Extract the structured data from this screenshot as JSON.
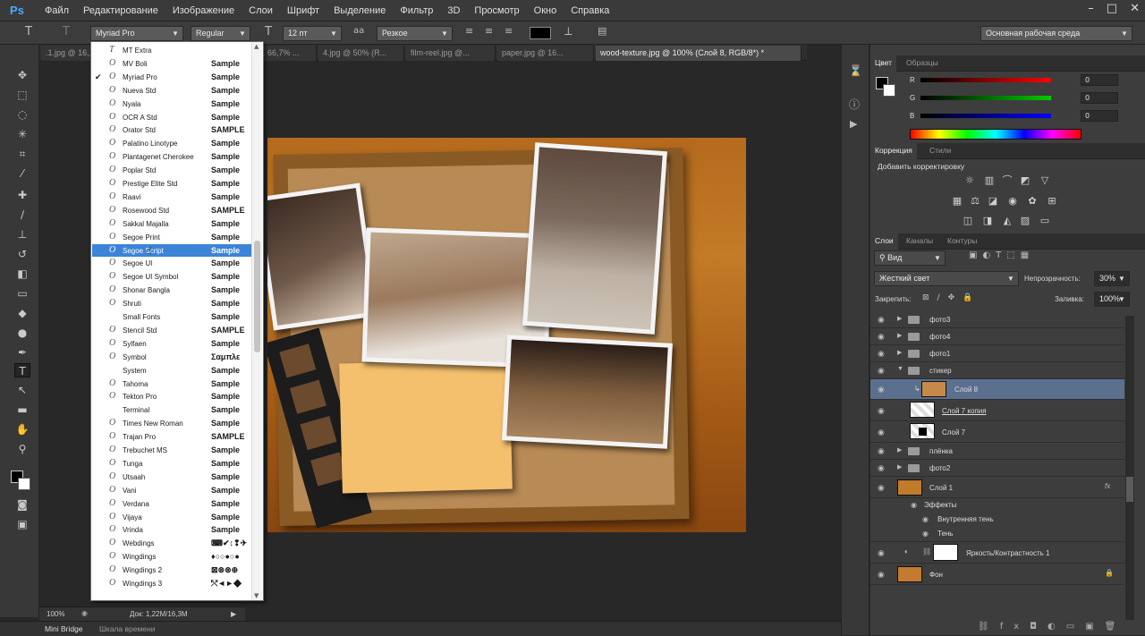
{
  "app": {
    "logo": "Ps"
  },
  "menu": [
    "Файл",
    "Редактирование",
    "Изображение",
    "Слои",
    "Шрифт",
    "Выделение",
    "Фильтр",
    "3D",
    "Просмотр",
    "Окно",
    "Справка"
  ],
  "window_controls": [
    "–",
    "□",
    "✕"
  ],
  "options": {
    "font_family": "Myriad Pro",
    "font_style": "Regular",
    "font_size": "12 пт",
    "antialias": "Резкое",
    "workspace": "Основная рабочая среда"
  },
  "tabs": [
    {
      "label": ".1.jpg @ 16,..."
    },
    {
      "label": "... 66,7% ..."
    },
    {
      "label": "4.jpg @ 50% (R..."
    },
    {
      "label": "film-reel.jpg @..."
    },
    {
      "label": "paper.jpg @ 16..."
    },
    {
      "label": "wood-texture.jpg @ 100% (Слой 8, RGB/8*) *"
    }
  ],
  "font_list": [
    {
      "name": "MT Extra",
      "sample": "",
      "icon": "T"
    },
    {
      "name": "MV Boli",
      "sample": "Sample",
      "icon": "O"
    },
    {
      "name": "Myriad Pro",
      "sample": "Sample",
      "icon": "O",
      "checked": true
    },
    {
      "name": "Nueva Std",
      "sample": "Sample",
      "icon": "O"
    },
    {
      "name": "Nyala",
      "sample": "Sample",
      "icon": "O"
    },
    {
      "name": "OCR A Std",
      "sample": "Sample",
      "icon": "O"
    },
    {
      "name": "Orator Std",
      "sample": "SAMPLE",
      "icon": "O"
    },
    {
      "name": "Palatino Linotype",
      "sample": "Sample",
      "icon": "O"
    },
    {
      "name": "Plantagenet Cherokee",
      "sample": "Sample",
      "icon": "O"
    },
    {
      "name": "Poplar Std",
      "sample": "Sample",
      "icon": "O"
    },
    {
      "name": "Prestige Elite Std",
      "sample": "Sample",
      "icon": "O"
    },
    {
      "name": "Raavi",
      "sample": "Sample",
      "icon": "O"
    },
    {
      "name": "Rosewood Std",
      "sample": "SAMPLE",
      "icon": "O"
    },
    {
      "name": "Sakkal Majalla",
      "sample": "Sample",
      "icon": "O"
    },
    {
      "name": "Segoe Print",
      "sample": "Sample",
      "icon": "O"
    },
    {
      "name": "Segoe Script",
      "sample": "Sample",
      "icon": "O",
      "selected": true
    },
    {
      "name": "Segoe UI",
      "sample": "Sample",
      "icon": "O"
    },
    {
      "name": "Segoe UI Symbol",
      "sample": "Sample",
      "icon": "O"
    },
    {
      "name": "Shonar Bangla",
      "sample": "Sample",
      "icon": "O"
    },
    {
      "name": "Shruti",
      "sample": "Sample",
      "icon": "O"
    },
    {
      "name": "Small Fonts",
      "sample": "Sample",
      "icon": ""
    },
    {
      "name": "Stencil Std",
      "sample": "SAMPLE",
      "icon": "O"
    },
    {
      "name": "Sylfaen",
      "sample": "Sample",
      "icon": "O"
    },
    {
      "name": "Symbol",
      "sample": "Σαμπλε",
      "icon": "O"
    },
    {
      "name": "System",
      "sample": "Sample",
      "icon": ""
    },
    {
      "name": "Tahoma",
      "sample": "Sample",
      "icon": "O"
    },
    {
      "name": "Tekton Pro",
      "sample": "Sample",
      "icon": "O"
    },
    {
      "name": "Terminal",
      "sample": "Sample",
      "icon": ""
    },
    {
      "name": "Times New Roman",
      "sample": "Sample",
      "icon": "O"
    },
    {
      "name": "Trajan Pro",
      "sample": "SAMPLE",
      "icon": "O"
    },
    {
      "name": "Trebuchet MS",
      "sample": "Sample",
      "icon": "O"
    },
    {
      "name": "Tunga",
      "sample": "Sample",
      "icon": "O"
    },
    {
      "name": "Utsaah",
      "sample": "Sample",
      "icon": "O"
    },
    {
      "name": "Vani",
      "sample": "Sample",
      "icon": "O"
    },
    {
      "name": "Verdana",
      "sample": "Sample",
      "icon": "O"
    },
    {
      "name": "Vijaya",
      "sample": "Sample",
      "icon": "O"
    },
    {
      "name": "Vrinda",
      "sample": "Sample",
      "icon": "O"
    },
    {
      "name": "Webdings",
      "sample": "⌨✔↕❢✈",
      "icon": "O"
    },
    {
      "name": "Wingdings",
      "sample": "♦○○●○●",
      "icon": "O"
    },
    {
      "name": "Wingdings 2",
      "sample": "⊠⊗⊗⊕",
      "icon": "O"
    },
    {
      "name": "Wingdings 3",
      "sample": "⤲◄►◆",
      "icon": "O"
    }
  ],
  "status": {
    "zoom": "100%",
    "doc": "Док: 1,22M/16,3M"
  },
  "bottom_tabs": [
    "Mini Bridge",
    "Шкала времени"
  ],
  "color_panel": {
    "tabs": [
      "Цвет",
      "Образцы"
    ],
    "sliders": [
      {
        "label": "R",
        "value": "0"
      },
      {
        "label": "G",
        "value": "0"
      },
      {
        "label": "B",
        "value": "0"
      }
    ]
  },
  "adjust_panel": {
    "tabs": [
      "Коррекция",
      "Стили"
    ],
    "title": "Добавить корректировку"
  },
  "layers_panel": {
    "tabs": [
      "Слои",
      "Каналы",
      "Контуры"
    ],
    "filter": "Вид",
    "blend_mode": "Жесткий свет",
    "opacity_label": "Непрозрачность:",
    "opacity": "30%",
    "lock_label": "Закрепить:",
    "fill_label": "Заливка:",
    "fill": "100%",
    "layers": [
      {
        "name": "фото3",
        "kind": "group"
      },
      {
        "name": "фото4",
        "kind": "group"
      },
      {
        "name": "фото1",
        "kind": "group"
      },
      {
        "name": "стикер",
        "kind": "group-open"
      },
      {
        "name": "Слой 8",
        "kind": "layer",
        "selected": true
      },
      {
        "name": "Слой 7 копия",
        "kind": "layer"
      },
      {
        "name": "Слой 7",
        "kind": "layer"
      },
      {
        "name": "плёнка",
        "kind": "group"
      },
      {
        "name": "фото2",
        "kind": "group"
      },
      {
        "name": "Слой 1",
        "kind": "layer",
        "fx": "fx"
      },
      {
        "name": "Эффекты",
        "kind": "effects"
      },
      {
        "name": "Внутренняя тень",
        "kind": "effect"
      },
      {
        "name": "Тень",
        "kind": "effect"
      },
      {
        "name": "Яркость/Контрастность 1",
        "kind": "adjustment"
      },
      {
        "name": "Фон",
        "kind": "background"
      }
    ]
  },
  "colors": {
    "accent": "#3b84d8",
    "panel": "#3d3d3d",
    "selection": "#5b6f8f"
  }
}
